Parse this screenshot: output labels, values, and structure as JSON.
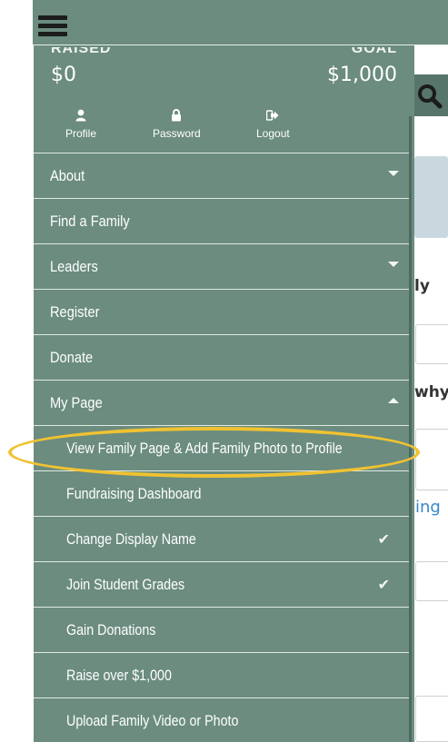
{
  "background": {
    "partial_heading_1": "ly",
    "partial_heading_2": "why",
    "partial_link": "ing"
  },
  "stats": {
    "raised_label": "RAISED",
    "raised_value": "$0",
    "goal_label": "GOAL",
    "goal_value": "$1,000"
  },
  "account": {
    "profile": "Profile",
    "password": "Password",
    "logout": "Logout"
  },
  "menu": {
    "about": "About",
    "find_family": "Find a Family",
    "leaders": "Leaders",
    "register": "Register",
    "donate": "Donate",
    "my_page": "My Page",
    "sub": [
      {
        "label": "View Family Page & Add Family Photo to Profile",
        "completed": false
      },
      {
        "label": "Fundraising Dashboard",
        "completed": false
      },
      {
        "label": "Change Display Name",
        "completed": true
      },
      {
        "label": "Join Student Grades",
        "completed": true
      },
      {
        "label": "Gain Donations",
        "completed": false
      },
      {
        "label": "Raise over $1,000",
        "completed": false
      },
      {
        "label": "Upload Family Video or Photo",
        "completed": false
      }
    ]
  },
  "colors": {
    "drawer_bg": "#6b8c7f",
    "highlight": "#f0c232",
    "link": "#3a86c8"
  }
}
